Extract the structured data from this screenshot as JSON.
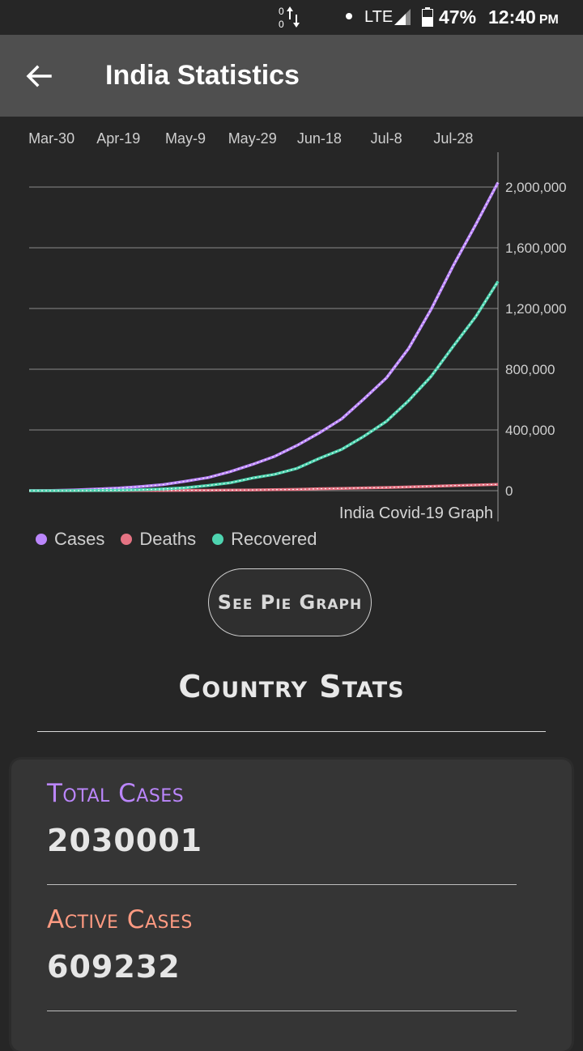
{
  "status_bar": {
    "network": "LTE",
    "data_up": "0",
    "data_down": "0",
    "battery": "47%",
    "time": "12:40",
    "ampm": "PM"
  },
  "app_bar": {
    "back_icon": "arrow-left-icon",
    "title": "India Statistics"
  },
  "chart_data": {
    "type": "line",
    "title": "India Covid-19 Graph",
    "x_tick_labels": [
      "Mar-30",
      "Apr-19",
      "May-9",
      "May-29",
      "Jun-18",
      "Jul-8",
      "Jul-28"
    ],
    "x": [
      "Mar-23",
      "Mar-30",
      "Apr-6",
      "Apr-13",
      "Apr-19",
      "Apr-26",
      "May-3",
      "May-9",
      "May-16",
      "May-23",
      "May-29",
      "Jun-5",
      "Jun-12",
      "Jun-18",
      "Jun-25",
      "Jul-2",
      "Jul-8",
      "Jul-15",
      "Jul-22",
      "Jul-28",
      "Aug-2",
      "Aug-6"
    ],
    "series": [
      {
        "name": "Cases",
        "color": "#bb86fc",
        "values": [
          500,
          1300,
          4800,
          10500,
          17000,
          27000,
          40000,
          62000,
          86000,
          125000,
          173000,
          226000,
          298000,
          381000,
          473000,
          605000,
          742000,
          937000,
          1193000,
          1483000,
          1751000,
          2030001
        ]
      },
      {
        "name": "Deaths",
        "color": "#e57383",
        "values": [
          10,
          30,
          120,
          350,
          560,
          830,
          1300,
          2100,
          2750,
          3700,
          4900,
          6350,
          8500,
          12600,
          15000,
          18000,
          20600,
          24300,
          28700,
          33400,
          37400,
          41600
        ]
      },
      {
        "name": "Recovered",
        "color": "#4ed4b0",
        "values": [
          40,
          130,
          400,
          1200,
          2800,
          6000,
          11000,
          19000,
          34000,
          52000,
          83000,
          108000,
          147000,
          213000,
          272000,
          359000,
          456000,
          593000,
          752000,
          952000,
          1145000,
          1378000
        ]
      }
    ],
    "ylim": [
      0,
      2000000
    ],
    "y_ticks": [
      "0",
      "400,000",
      "800,000",
      "1,200,000",
      "1,600,000",
      "2,000,000"
    ],
    "y_axis_position": "right",
    "grid": true,
    "legend_position": "bottom-left"
  },
  "pie_button": {
    "label": "See Pie Graph"
  },
  "country_stats": {
    "title": "Country Stats",
    "items": [
      {
        "label": "Total Cases",
        "value": "2030001",
        "color": "#bb86fc"
      },
      {
        "label": "Active Cases",
        "value": "609232",
        "color": "#ff9b82"
      }
    ]
  }
}
